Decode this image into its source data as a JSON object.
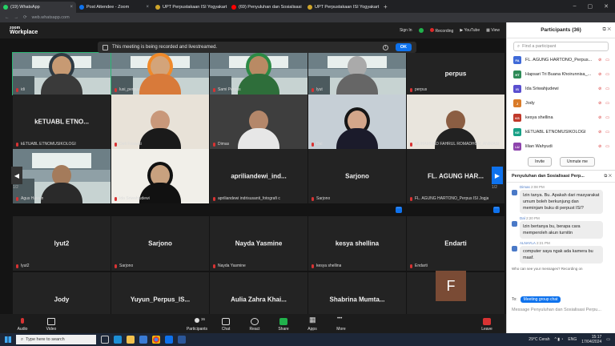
{
  "browser": {
    "tabs": [
      {
        "title": "(19) WhatsApp",
        "color": "#25d366"
      },
      {
        "title": "Post Attendee - Zoom",
        "color": "#0e72ed"
      },
      {
        "title": "UPT Perpustakaan ISI Yogyakart",
        "color": "#cfa52a"
      },
      {
        "title": "(69) Penyuluhan dan Sosialisasi",
        "color": "#ff0000"
      },
      {
        "title": "UPT Perpustakaan ISI Yogyakart",
        "color": "#cfa52a"
      }
    ],
    "address": "web.whatsapp.com"
  },
  "zoom": {
    "logo_top": "zoom",
    "logo_bottom": "Workplace",
    "signin": "Sign In",
    "recording": "Recording",
    "youtube": "YouTube",
    "view": "View",
    "banner": "This meeting is being recorded and livestreamed.",
    "ok": "OK",
    "page_left": "1/2",
    "page_right": "1/2"
  },
  "tiles": [
    {
      "label": "idi",
      "type": "video",
      "hl": true
    },
    {
      "label": "lusi_perpus",
      "type": "video"
    },
    {
      "label": "Sami Perpus",
      "type": "video"
    },
    {
      "label": "lyut",
      "type": "video"
    },
    {
      "label": "perpus",
      "name": "perpus",
      "type": "name"
    },
    {
      "label": "kETUABL ETNOMUSIKOLOGI",
      "name": "kETUABL ETNO...",
      "type": "name"
    },
    {
      "label": "Defi Firawati",
      "type": "video"
    },
    {
      "label": "Dimas",
      "type": "video"
    },
    {
      "label": "Dal",
      "type": "video"
    },
    {
      "label": "MUHAMMAD FAHRUL ROMADHON_ANIMASI",
      "type": "video"
    },
    {
      "label": "Agus Hawan",
      "type": "video"
    },
    {
      "label": "Ida Sriwahjudewi",
      "type": "video"
    },
    {
      "label": "apriliandewi indrisusanti_fotografi c",
      "name": "apriliandewi_ind...",
      "type": "name"
    },
    {
      "label": "Sarjono",
      "name": "Sarjono",
      "type": "name"
    },
    {
      "label": "FL. AGUNG HARTONO_Perpus ISI Jogja",
      "name": "FL. AGUNG HAR...",
      "type": "name"
    },
    {
      "label": "lyut2",
      "name": "lyut2",
      "type": "name"
    },
    {
      "label": "Sarjono",
      "name": "Sarjono",
      "type": "name"
    },
    {
      "label": "Nayda Yasmine",
      "name": "Nayda Yasmine",
      "type": "name"
    },
    {
      "label": "kesya shellina",
      "name": "kesya shellina",
      "type": "name"
    },
    {
      "label": "Endarti",
      "name": "Endarti",
      "type": "name"
    },
    {
      "label": "Jody",
      "name": "Jody",
      "type": "name"
    },
    {
      "label": "Yuyun_Perpus ISI Yk",
      "name": "Yuyun_Perpus_IS...",
      "type": "name"
    },
    {
      "label": "Aulia Zahra Khairunnisa_ANIMASI",
      "name": "Aulia Zahra Khai...",
      "type": "name"
    },
    {
      "label": "Shabrina Muntaz anim",
      "name": "Shabrina Mumta...",
      "type": "name"
    },
    {
      "label": "Faidha Rahmani Budiarta_animasi A",
      "name": "",
      "type": "avatar"
    }
  ],
  "avatar_letter": "F",
  "toolbar": {
    "audio": "Audio",
    "video": "Video",
    "participants": "Participants",
    "participants_count": "36",
    "chat": "Chat",
    "react": "React",
    "share": "Share",
    "apps": "Apps",
    "more": "More",
    "leave": "Leave"
  },
  "panel": {
    "title": "Participants (36)",
    "find_placeholder": "Find a participant",
    "participants": [
      {
        "initials": "FA",
        "name": "FL. AGUNG HARTONO_Perpus...",
        "color": "#3f6ad8"
      },
      {
        "initials": "HT",
        "name": "Hapsari Tri Buana Khoirunnisa_...",
        "color": "#2e8b57"
      },
      {
        "initials": "IS",
        "name": "Ida Sriwahjudewi",
        "color": "#5a4fcf"
      },
      {
        "initials": "J",
        "name": "Jody",
        "color": "#d97b29"
      },
      {
        "initials": "KS",
        "name": "kesya shellina",
        "color": "#c0392b"
      },
      {
        "initials": "KE",
        "name": "kETUABL ETNOMUSIKOLOGI",
        "color": "#16a085"
      },
      {
        "initials": "LU",
        "name": "lilian Wahyudi",
        "color": "#8e44ad"
      }
    ],
    "invite": "Invite",
    "unmute_me": "Unmute me",
    "chat_title": "Penyuluhan dan Sosialisasi Perp...",
    "messages": [
      {
        "from": "Dimas",
        "time": "2:08 PM",
        "text": "Izin tanya. Bu. Apakah dari masyarakat umum boleh berkunjung dan meminjam buku di perpust ISI?"
      },
      {
        "from": "Dal",
        "time": "2:20 PM",
        "text": "Izin bertanya bu, berapa cara memperoleh akun turnitin"
      },
      {
        "from": "ALNAYLA",
        "time": "2:21 PM",
        "text": "computer saya ngak ada kamera bu maaf."
      }
    ],
    "who_notice": "Who can see your messages? Recording on",
    "to_label": "To:",
    "to_value": "Meeting group chat",
    "input_placeholder": "Message Penyuluhan dan Sosialisasi Perpu..."
  },
  "taskbar": {
    "search_placeholder": "Type here to search",
    "weather": "29°C  Cerah",
    "lang": "ENG",
    "time": "15:17",
    "date": "17/04/2024"
  }
}
